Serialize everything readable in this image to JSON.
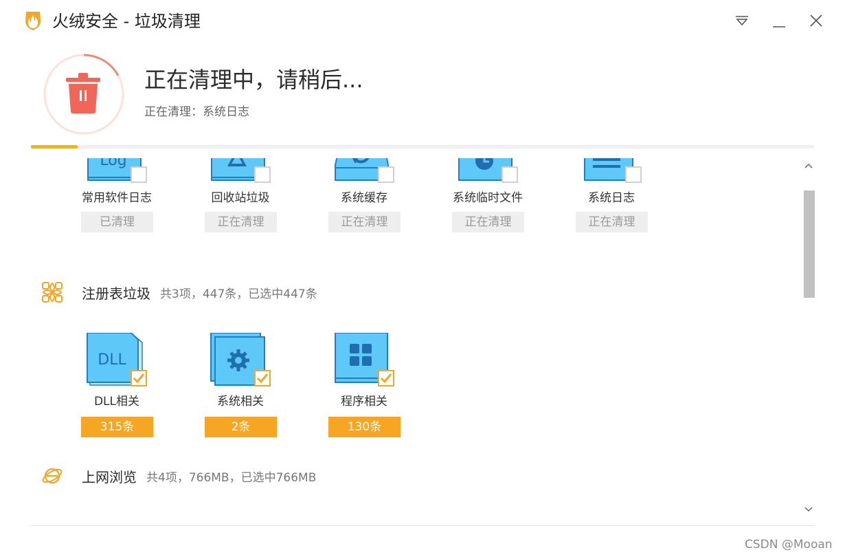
{
  "window": {
    "title": "火绒安全 - 垃圾清理",
    "buttons": [
      "menu-icon",
      "minimize-icon",
      "close-icon"
    ]
  },
  "status": {
    "title": "正在清理中，请稍后...",
    "current_label": "正在清理：",
    "current_item": "系统日志",
    "progress_fraction": 0.06
  },
  "system_items": [
    {
      "label": "常用软件日志",
      "badge": "已清理",
      "icon": "log-file-icon",
      "checked": false
    },
    {
      "label": "回收站垃圾",
      "badge": "正在清理",
      "icon": "recycle-bin-icon",
      "checked": false
    },
    {
      "label": "系统缓存",
      "badge": "正在清理",
      "icon": "system-cache-icon",
      "checked": false
    },
    {
      "label": "系统临时文件",
      "badge": "正在清理",
      "icon": "temp-folder-icon",
      "checked": false
    },
    {
      "label": "系统日志",
      "badge": "正在清理",
      "icon": "system-log-icon",
      "checked": false
    }
  ],
  "registry": {
    "title": "注册表垃圾",
    "summary": "共3项，447条，已选中447条",
    "items": [
      {
        "label": "DLL相关",
        "badge": "315条",
        "icon": "dll-file-icon",
        "checked": true
      },
      {
        "label": "系统相关",
        "badge": "2条",
        "icon": "system-gear-icon",
        "checked": true
      },
      {
        "label": "程序相关",
        "badge": "130条",
        "icon": "program-grid-icon",
        "checked": true
      }
    ]
  },
  "browsing": {
    "title": "上网浏览",
    "summary": "共4项，766MB，已选中766MB"
  },
  "watermark": "CSDN @Mooan",
  "colors": {
    "accent_orange": "#f6a623",
    "progress_yellow": "#f7b500",
    "icon_blue": "#5ec8f8",
    "icon_dark_blue": "#1f7fc1",
    "trash_red": "#f0675a"
  }
}
